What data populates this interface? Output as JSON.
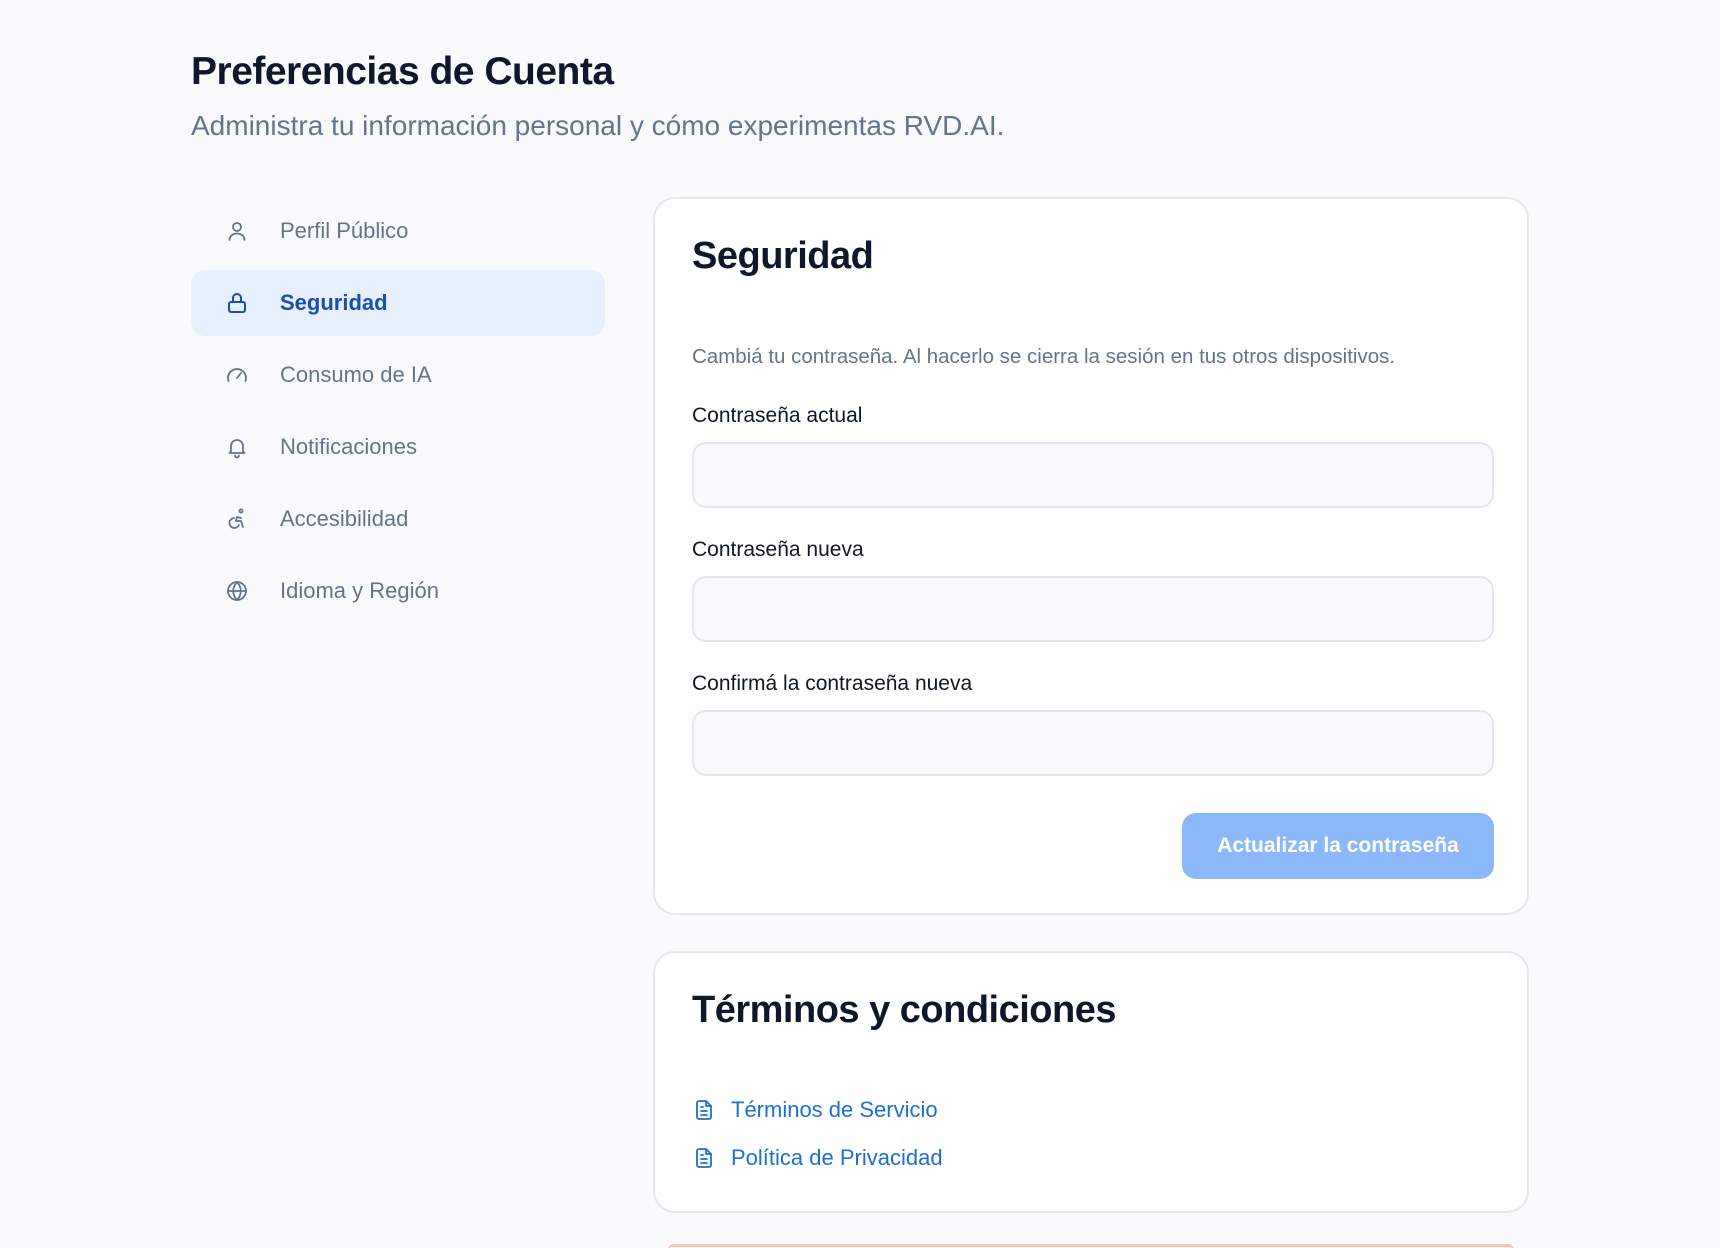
{
  "header": {
    "title": "Preferencias de Cuenta",
    "subtitle": "Administra tu información personal y cómo experimentas RVD.AI."
  },
  "sidebar": {
    "items": [
      {
        "label": "Perfil Público",
        "icon": "user-icon",
        "active": false
      },
      {
        "label": "Seguridad",
        "icon": "lock-icon",
        "active": true
      },
      {
        "label": "Consumo de IA",
        "icon": "gauge-icon",
        "active": false
      },
      {
        "label": "Notificaciones",
        "icon": "bell-icon",
        "active": false
      },
      {
        "label": "Accesibilidad",
        "icon": "accessibility-icon",
        "active": false
      },
      {
        "label": "Idioma y Región",
        "icon": "globe-icon",
        "active": false
      }
    ]
  },
  "security": {
    "title": "Seguridad",
    "description": "Cambiá tu contraseña. Al hacerlo se cierra la sesión en tus otros dispositivos.",
    "fields": [
      {
        "label": "Contraseña actual",
        "value": ""
      },
      {
        "label": "Contraseña nueva",
        "value": ""
      },
      {
        "label": "Confirmá la contraseña nueva",
        "value": ""
      }
    ],
    "submit_label": "Actualizar la contraseña"
  },
  "terms": {
    "title": "Términos y condiciones",
    "links": [
      {
        "label": "Términos de Servicio",
        "icon": "document-icon"
      },
      {
        "label": "Política de Privacidad",
        "icon": "document-icon"
      }
    ]
  },
  "colors": {
    "accent": "#1e4db0",
    "active_bg": "#e6f0fe",
    "button_disabled": "#8ab8f8",
    "link": "#1d6fd1",
    "muted_text": "#64748b"
  }
}
